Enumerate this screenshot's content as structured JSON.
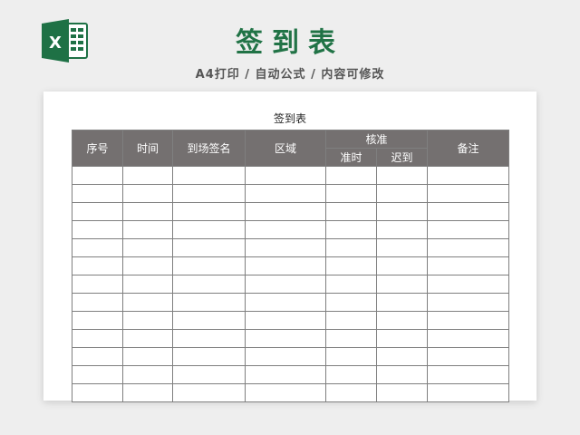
{
  "header": {
    "app_icon": "excel-icon",
    "app_icon_letter": "X",
    "title": "签到表",
    "subtitle": "A4打印 / 自动公式 / 内容可修改",
    "accent_color": "#217346"
  },
  "sheet": {
    "caption": "签到表",
    "header_color": "#747070",
    "columns": {
      "seq": "序号",
      "time": "时间",
      "arrival_signature": "到场签名",
      "area": "区域",
      "verify_group": "核准",
      "on_time": "准时",
      "late": "迟到",
      "remarks": "备注"
    },
    "empty_row_count": 13
  }
}
